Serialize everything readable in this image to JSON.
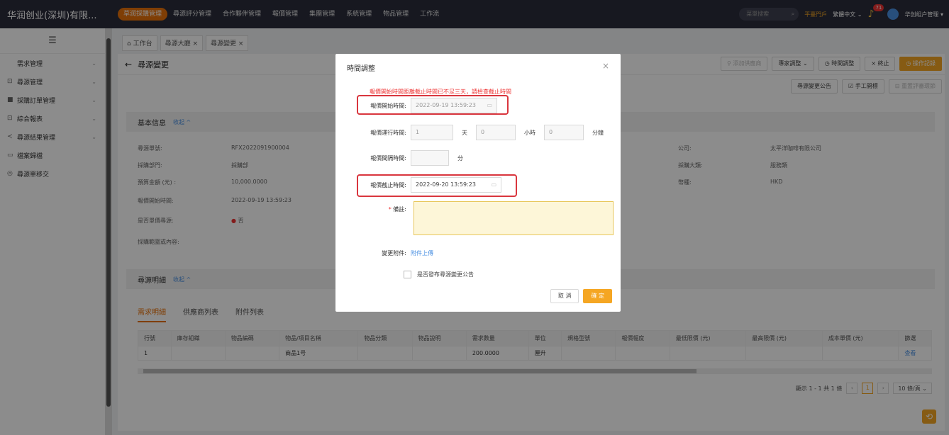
{
  "brand": "华润创业(深圳)有限...",
  "topnav": [
    "草润採購管理",
    "尋源評分管理",
    "合作夥伴管理",
    "報價管理",
    "集團管理",
    "系統管理",
    "物品管理",
    "工作流"
  ],
  "topright": {
    "search_placeholder": "菜單搜索",
    "portal": "平臺門戶",
    "language": "繁體中文 ⌄",
    "notifications": "71",
    "user": "华创组户管理 ▾"
  },
  "sidebar": [
    {
      "icon": "",
      "label": "需求管理"
    },
    {
      "icon": "⊡",
      "label": "尋源管理"
    },
    {
      "icon": "■",
      "label": "採購訂單管理"
    },
    {
      "icon": "⊡",
      "label": "綜合報表"
    },
    {
      "icon": "≺",
      "label": "尋源結果管理"
    },
    {
      "icon": "▭",
      "label": "檔案歸檔"
    },
    {
      "icon": "◎",
      "label": "尋源單移交"
    }
  ],
  "tabs": [
    "⌂ 工作台",
    "尋源大廳 ×",
    "尋源變更 ×"
  ],
  "page_title": "尋源變更",
  "toolbar1": [
    "⚲ 添加供應商",
    "專家調整 ⌄",
    "◷ 時間調整",
    "× 終止",
    "◷ 操作記錄"
  ],
  "toolbar2": [
    "尋源變更公告",
    "☑ 手工開標",
    "⊟ 重置評審環節"
  ],
  "basic_info": {
    "title": "基本信息",
    "collapse": "收起 ^",
    "fields": [
      {
        "label": "尋源單號:",
        "value": "RFX2022091900004"
      },
      {
        "label": "採購部門:",
        "value": "採購部"
      },
      {
        "label": "預算金額 (元) :",
        "value": "10,000.0000"
      },
      {
        "label": "報價開始時間:",
        "value": "2022-09-19 13:59:23"
      },
      {
        "label": "是否單價尋源:",
        "value": "否"
      },
      {
        "label": "採購範圍或內容:",
        "value": ""
      }
    ],
    "right_fields": [
      {
        "label": "公司:",
        "value": "太平洋咖啡有限公司"
      },
      {
        "label": "採購大類:",
        "value": "服務類"
      },
      {
        "label": "幣種:",
        "value": "HKD"
      }
    ]
  },
  "detail_section": {
    "title": "尋源明細",
    "collapse": "收起 ^"
  },
  "subtabs": [
    "需求明細",
    "供應商列表",
    "附件列表"
  ],
  "table": {
    "headers": [
      "行號",
      "庫存組織",
      "物品編碼",
      "物品/項目名稱",
      "物品分類",
      "物品說明",
      "需求數量",
      "單位",
      "規格型號",
      "報價幅度",
      "最低限價 (元)",
      "最高限價 (元)",
      "成本單價 (元)",
      "篩選"
    ],
    "rows": [
      [
        "1",
        "",
        "",
        "商品1号",
        "",
        "",
        "200.0000",
        "厘升",
        "",
        "",
        "",
        "",
        "",
        "查看"
      ]
    ]
  },
  "pager": {
    "summary": "顯示 1 - 1 共 1 條",
    "current": "1",
    "page_size": "10 條/頁 ⌄"
  },
  "modal": {
    "title": "時間調整",
    "warning": "報價開始時間距離截止時間已不足三天，請檢查截止時間",
    "start_label": "報價開始時間:",
    "start_value": "2022-09-19 13:59:23",
    "duration_label": "報價運行時間:",
    "days_value": "1",
    "days_unit": "天",
    "hours_value": "0",
    "hours_unit": "小時",
    "minutes_value": "0",
    "minutes_unit": "分鐘",
    "interval_label": "報價間隔時間:",
    "interval_unit": "分",
    "end_label": "報價截止時間:",
    "end_value": "2022-09-20 13:59:23",
    "remark_label": "備註:",
    "attach_label": "變更附件:",
    "attach_link": "附件上傳",
    "publish_label": "是否發布尋源變更公告",
    "cancel": "取 消",
    "confirm": "確 定"
  }
}
